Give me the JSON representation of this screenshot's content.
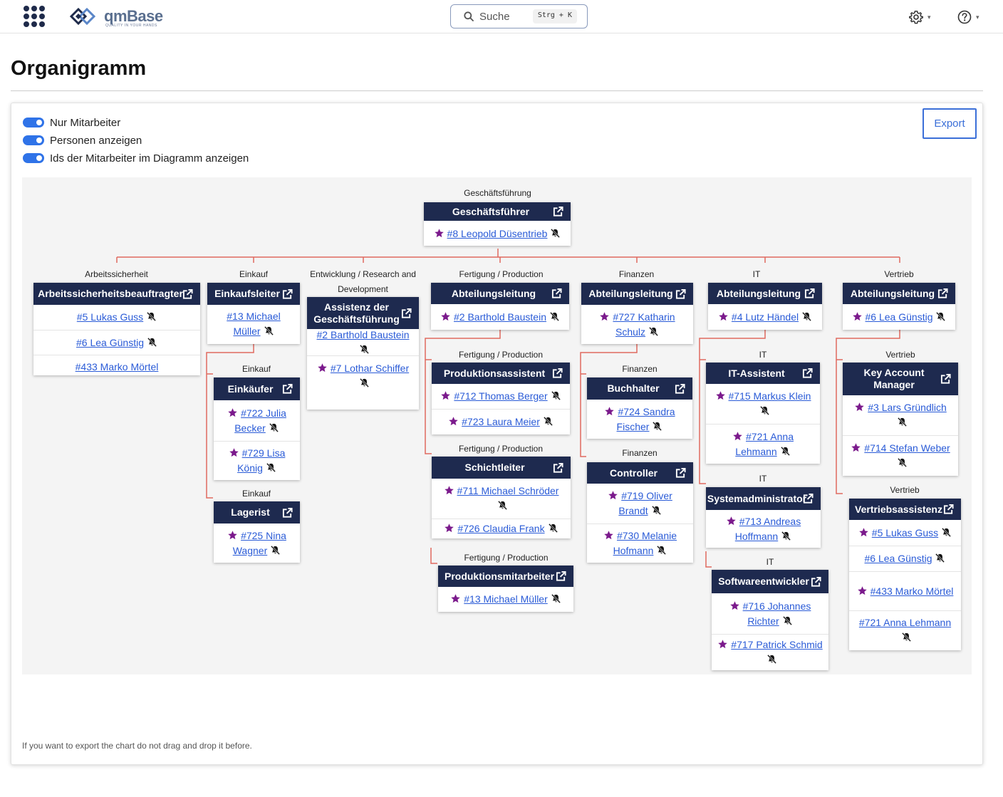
{
  "header": {
    "logo_text": "qmBase",
    "logo_sub": "QUALITY IN YOUR HANDS",
    "search_label": "Suche",
    "search_kbd": "Strg + K"
  },
  "page": {
    "title": "Organigramm",
    "export_label": "Export",
    "hint": "If you want to export the chart do not drag and drop it before."
  },
  "toggles": [
    {
      "label": "Nur Mitarbeiter",
      "on": true
    },
    {
      "label": "Personen anzeigen",
      "on": true
    },
    {
      "label": "Ids der Mitarbeiter im Diagramm anzeigen",
      "on": true
    }
  ],
  "colors": {
    "accent": "#2f73e8",
    "node_header": "#1e2a4f",
    "connector": "#e06a5f",
    "star": "#7b1a8c",
    "link": "#2a5bd7"
  },
  "departments": [
    "Geschäftsführung",
    "Arbeitssicherheit",
    "Einkauf",
    "Entwicklung / Research and Development",
    "Fertigung / Production",
    "Finanzen",
    "IT",
    "Vertrieb",
    "Einkauf",
    "Einkauf",
    "Fertigung / Production",
    "Fertigung / Production",
    "Fertigung / Production",
    "Finanzen",
    "Finanzen",
    "IT",
    "IT",
    "IT",
    "Vertrieb",
    "Vertrieb"
  ],
  "nodes": [
    {
      "title": "Geschäftsführer",
      "people": [
        {
          "text": "#8 Leopold Düsentrieb",
          "star": true,
          "bell": true
        }
      ]
    },
    {
      "title": "Arbeitssicherheitsbeauftragter",
      "people": [
        {
          "text": "#5 Lukas Guss",
          "star": false,
          "bell": true
        },
        {
          "text": "#6 Lea Günstig",
          "star": false,
          "bell": true
        },
        {
          "text": "#433 Marko Mörtel",
          "star": false,
          "bell": false
        }
      ]
    },
    {
      "title": "Einkaufsleiter",
      "people": [
        {
          "text": "#13 Michael Müller",
          "star": false,
          "bell": true
        }
      ]
    },
    {
      "title": "Assistenz der Geschäftsführung",
      "people": [
        {
          "text": "#2 Barthold Baustein",
          "star": false,
          "bell": true
        },
        {
          "text": "#7 Lothar Schiffer",
          "star": true,
          "bell": true
        }
      ]
    },
    {
      "title": "Abteilungsleitung",
      "people": [
        {
          "text": "#2 Barthold Baustein",
          "star": true,
          "bell": true
        }
      ]
    },
    {
      "title": "Abteilungsleitung",
      "people": [
        {
          "text": "#727 Katharin Schulz",
          "star": true,
          "bell": true
        }
      ]
    },
    {
      "title": "Abteilungsleitung",
      "people": [
        {
          "text": "#4 Lutz Händel",
          "star": true,
          "bell": true
        }
      ]
    },
    {
      "title": "Abteilungsleitung",
      "people": [
        {
          "text": "#6 Lea Günstig",
          "star": true,
          "bell": true
        }
      ]
    },
    {
      "title": "Einkäufer",
      "people": [
        {
          "text": "#722 Julia Becker",
          "star": true,
          "bell": true
        },
        {
          "text": "#729 Lisa König",
          "star": true,
          "bell": true
        }
      ]
    },
    {
      "title": "Lagerist",
      "people": [
        {
          "text": "#725 Nina Wagner",
          "star": true,
          "bell": true
        }
      ]
    },
    {
      "title": "Produktionsassistent",
      "people": [
        {
          "text": "#712 Thomas Berger",
          "star": true,
          "bell": true
        },
        {
          "text": "#723 Laura Meier",
          "star": true,
          "bell": true
        }
      ]
    },
    {
      "title": "Schichtleiter",
      "people": [
        {
          "text": "#711 Michael Schröder",
          "star": true,
          "bell": true
        },
        {
          "text": "#726 Claudia Frank",
          "star": true,
          "bell": true
        }
      ]
    },
    {
      "title": "Produktionsmitarbeiter",
      "people": [
        {
          "text": "#13 Michael Müller",
          "star": true,
          "bell": true
        }
      ]
    },
    {
      "title": "Buchhalter",
      "people": [
        {
          "text": "#724 Sandra Fischer",
          "star": true,
          "bell": true
        }
      ]
    },
    {
      "title": "Controller",
      "people": [
        {
          "text": "#719 Oliver Brandt",
          "star": true,
          "bell": true
        },
        {
          "text": "#730 Melanie Hofmann",
          "star": true,
          "bell": true
        }
      ]
    },
    {
      "title": "IT-Assistent",
      "people": [
        {
          "text": "#715 Markus Klein",
          "star": true,
          "bell": true
        },
        {
          "text": "#721 Anna Lehmann",
          "star": true,
          "bell": true
        }
      ]
    },
    {
      "title": "Systemadministrator",
      "people": [
        {
          "text": "#713 Andreas Hoffmann",
          "star": true,
          "bell": true
        }
      ]
    },
    {
      "title": "Softwareentwickler",
      "people": [
        {
          "text": "#716 Johannes Richter",
          "star": true,
          "bell": true
        },
        {
          "text": "#717 Patrick Schmid",
          "star": true,
          "bell": true
        }
      ]
    },
    {
      "title": "Key Account Manager",
      "people": [
        {
          "text": "#3 Lars Gründlich",
          "star": true,
          "bell": true
        },
        {
          "text": "#714 Stefan Weber",
          "star": true,
          "bell": true
        }
      ]
    },
    {
      "title": "Vertriebsassistenz",
      "people": [
        {
          "text": "#5 Lukas Guss",
          "star": true,
          "bell": true
        },
        {
          "text": "#6 Lea Günstig",
          "star": false,
          "bell": true
        },
        {
          "text": "#433 Marko Mörtel",
          "star": true,
          "bell": false
        },
        {
          "text": "#721 Anna Lehmann",
          "star": false,
          "bell": true
        }
      ]
    }
  ]
}
